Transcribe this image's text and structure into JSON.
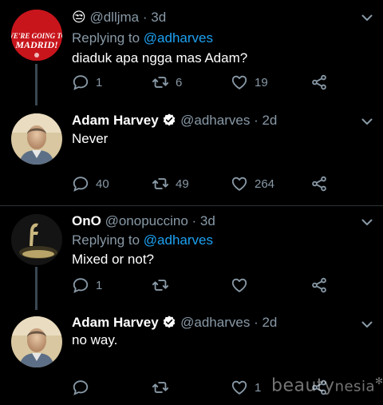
{
  "tweets": [
    {
      "handle": "@dlljma",
      "emoji": "😒",
      "time": "· 3d",
      "replying_prefix": "Replying to ",
      "replying_to": "@adharves",
      "text": "diaduk apa ngga mas Adam?",
      "replies": "1",
      "retweets": "6",
      "likes": "19",
      "avatar_text": "WE'RE GOING TO MADRID!"
    },
    {
      "name": "Adam Harvey",
      "handle": "@adharves",
      "time": "· 2d",
      "text": "Never",
      "replies": "40",
      "retweets": "49",
      "likes": "264"
    },
    {
      "name": "OnO",
      "handle": "@onopuccino",
      "time": "· 3d",
      "replying_prefix": "Replying to ",
      "replying_to": "@adharves",
      "text": "Mixed or not?",
      "replies": "1",
      "retweets": "",
      "likes": ""
    },
    {
      "name": "Adam Harvey",
      "handle": "@adharves",
      "time": "· 2d",
      "text": "no way.",
      "replies": "",
      "retweets": "",
      "likes": "1"
    }
  ],
  "watermark": {
    "brand": "beauty",
    "suffix": "nesia",
    "star": "✻"
  },
  "colors": {
    "background": "#000000",
    "muted": "#8899a6",
    "link": "#1da1f2",
    "verified": "#ffffff"
  },
  "icons": [
    "reply-icon",
    "retweet-icon",
    "like-icon",
    "share-icon",
    "chevron-down-icon",
    "verified-badge-icon"
  ]
}
